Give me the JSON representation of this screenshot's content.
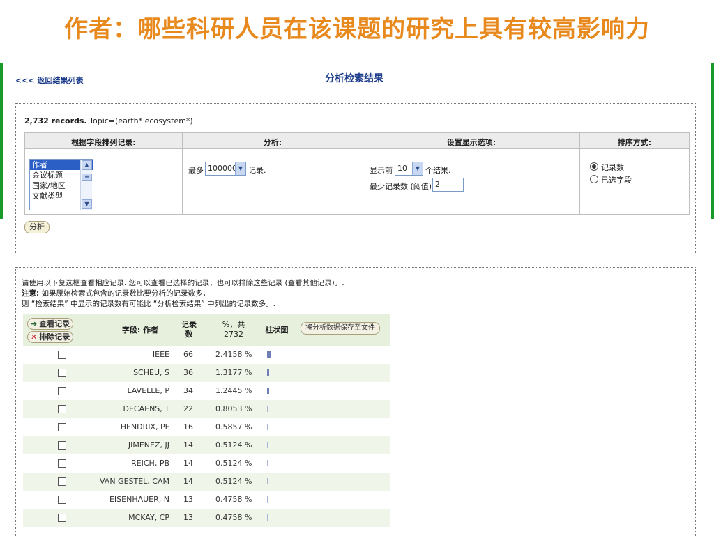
{
  "slide": {
    "title": "作者：哪些科研人员在该课题的研究上具有较高影响力"
  },
  "nav": {
    "back_link": "<<< 返回结果列表",
    "page_heading": "分析检索结果"
  },
  "search": {
    "record_count": "2,732 records.",
    "query": "Topic=(earth* ecosystem*)"
  },
  "options": {
    "headers": [
      "根据字段排列记录:",
      "分析:",
      "设置显示选项:",
      "排序方式:"
    ],
    "rank_fields": [
      "作者",
      "会议标题",
      "国家/地区",
      "文献类型"
    ],
    "selected_field_index": 0,
    "max_prefix": "最多",
    "max_value": "100000",
    "max_suffix": "记录.",
    "show_prefix": "显示前",
    "show_value": "10",
    "show_suffix": "个结果.",
    "min_label": "最少记录数 (阈值):",
    "min_value": "2",
    "sort_options": [
      "记录数",
      "已选字段"
    ],
    "selected_sort_index": 0
  },
  "analyze_button": "分析",
  "notes": {
    "line1": "请使用以下复选框查看相应记录. 您可以查看已选择的记录，也可以排除这些记录 (查看其他记录)。.",
    "line2_bold": "注意:",
    "line2": " 如果原始检索式包含的记录数比要分析的记录数多，",
    "line3": "则 “检索结果” 中显示的记录数有可能比 “分析检索结果” 中列出的记录数多。."
  },
  "results": {
    "view_button": "查看记录",
    "exclude_button": "排除记录",
    "col_field": "字段: 作者",
    "col_count_line1": "记录",
    "col_count_line2": "数",
    "col_pct_line1": "%，共",
    "col_pct_line2": "2732",
    "col_bar": "柱状图",
    "save_button": "将分析数据保存至文件",
    "rows": [
      {
        "name": "IEEE",
        "count": 66,
        "pct": "2.4158 %",
        "pct_value": 2.4158
      },
      {
        "name": "SCHEU, S",
        "count": 36,
        "pct": "1.3177 %",
        "pct_value": 1.3177
      },
      {
        "name": "LAVELLE, P",
        "count": 34,
        "pct": "1.2445 %",
        "pct_value": 1.2445
      },
      {
        "name": "DECAENS, T",
        "count": 22,
        "pct": "0.8053 %",
        "pct_value": 0.8053
      },
      {
        "name": "HENDRIX, PF",
        "count": 16,
        "pct": "0.5857 %",
        "pct_value": 0.5857
      },
      {
        "name": "JIMENEZ, JJ",
        "count": 14,
        "pct": "0.5124 %",
        "pct_value": 0.5124
      },
      {
        "name": "REICH, PB",
        "count": 14,
        "pct": "0.5124 %",
        "pct_value": 0.5124
      },
      {
        "name": "VAN GESTEL, CAM",
        "count": 14,
        "pct": "0.5124 %",
        "pct_value": 0.5124
      },
      {
        "name": "EISENHAUER, N",
        "count": 13,
        "pct": "0.4758 %",
        "pct_value": 0.4758
      },
      {
        "name": "MCKAY, CP",
        "count": 13,
        "pct": "0.4758 %",
        "pct_value": 0.4758
      }
    ]
  },
  "colors": {
    "title_orange": "#e8891e",
    "side_green": "#1a9a2a",
    "link_blue": "#1a3a8a",
    "row_green": "#e7f0dd"
  }
}
